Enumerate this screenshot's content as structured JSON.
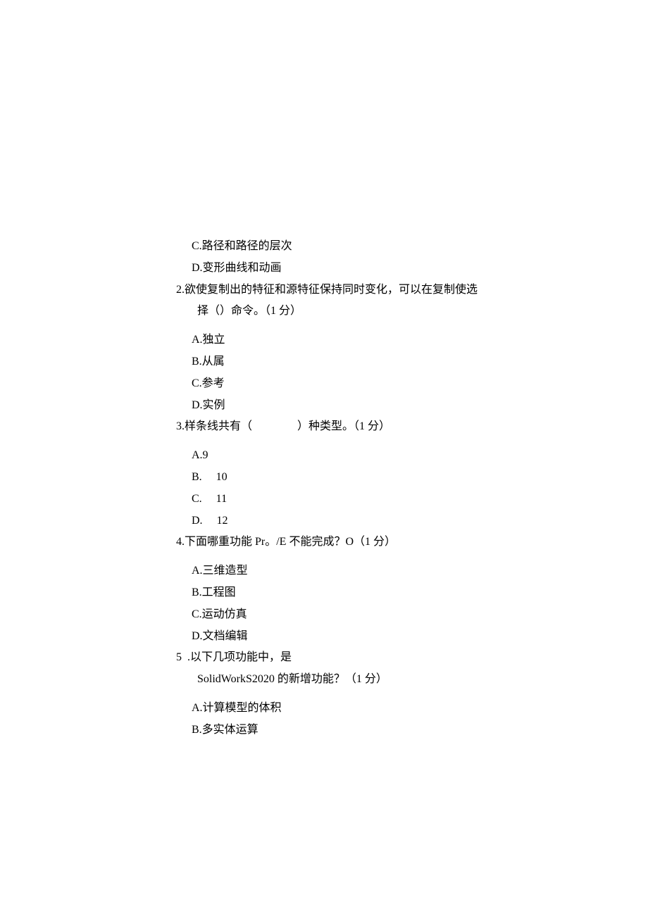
{
  "q1_tail": {
    "optC": "C.路径和路径的层次",
    "optD": "D.变形曲线和动画"
  },
  "q2": {
    "stem": "2.欲使复制出的特征和源特征保持同时变化，可以在复制使选",
    "stem2": "择（）命令。（1 分）",
    "optA": "A.独立",
    "optB": "B.从属",
    "optC": "C.参考",
    "optD": "D.实例"
  },
  "q3": {
    "stem": "3.样条线共有（　　　　）种类型。（1 分）",
    "optA": "A.9",
    "optB": "B.  10",
    "optC": "C.  11",
    "optD": "D.  12"
  },
  "q4": {
    "stem": "4.下面哪重功能 Pr。/E 不能完成？O（1 分）",
    "optA": "A.三维造型",
    "optB": "B.工程图",
    "optC": "C.运动仿真",
    "optD": "D.文档编辑"
  },
  "q5": {
    "stem1_num": "5",
    "stem1_text": " .以下几项功能中，是",
    "stem2": "SolidWorkS2020 的新增功能？（1 分）",
    "optA": "A.计算模型的体积",
    "optB": "B.多实体运算"
  }
}
